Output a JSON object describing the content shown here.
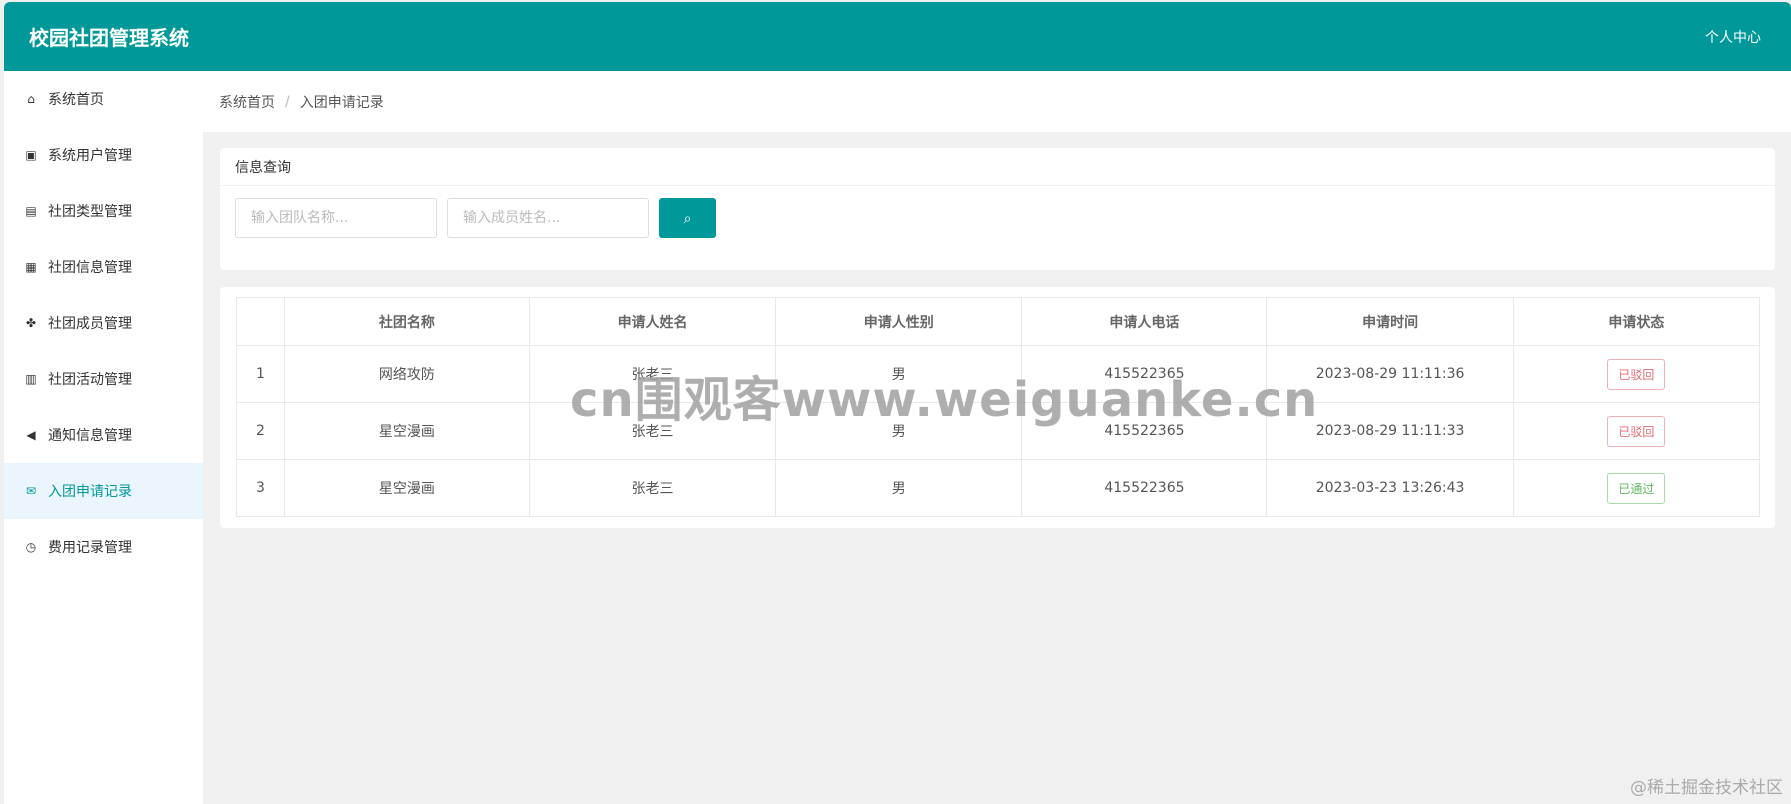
{
  "header": {
    "title": "校园社团管理系统",
    "user_center": "个人中心"
  },
  "sidebar": {
    "items": [
      {
        "label": "系统首页",
        "icon": "home-icon",
        "glyph": "⌂"
      },
      {
        "label": "系统用户管理",
        "icon": "address-book-icon",
        "glyph": "▣"
      },
      {
        "label": "社团类型管理",
        "icon": "building-icon",
        "glyph": "▤"
      },
      {
        "label": "社团信息管理",
        "icon": "train-icon",
        "glyph": "▦"
      },
      {
        "label": "社团成员管理",
        "icon": "cubes-icon",
        "glyph": "✤"
      },
      {
        "label": "社团活动管理",
        "icon": "calculator-icon",
        "glyph": "▥"
      },
      {
        "label": "通知信息管理",
        "icon": "bullhorn-icon",
        "glyph": "◀"
      },
      {
        "label": "入团申请记录",
        "icon": "envelope-open-icon",
        "glyph": "✉",
        "active": true
      },
      {
        "label": "费用记录管理",
        "icon": "clock-icon",
        "glyph": "◷"
      }
    ]
  },
  "breadcrumb": {
    "home": "系统首页",
    "sep": "/",
    "current": "入团申请记录"
  },
  "search": {
    "title": "信息查询",
    "team_placeholder": "输入团队名称...",
    "member_placeholder": "输入成员姓名...",
    "button_icon": "search-icon",
    "button_glyph": "⌕"
  },
  "table": {
    "headers": [
      "",
      "社团名称",
      "申请人姓名",
      "申请人性别",
      "申请人电话",
      "申请时间",
      "申请状态"
    ],
    "rows": [
      {
        "no": "1",
        "club": "网络攻防",
        "name": "张老三",
        "gender": "男",
        "phone": "415522365",
        "time": "2023-08-29 11:11:36",
        "status": "已驳回",
        "status_color": "#e06c75"
      },
      {
        "no": "2",
        "club": "星空漫画",
        "name": "张老三",
        "gender": "男",
        "phone": "415522365",
        "time": "2023-08-29 11:11:33",
        "status": "已驳回",
        "status_color": "#e06c75"
      },
      {
        "no": "3",
        "club": "星空漫画",
        "name": "张老三",
        "gender": "男",
        "phone": "415522365",
        "time": "2023-03-23 13:26:43",
        "status": "已通过",
        "status_color": "#5fb85f"
      }
    ]
  },
  "watermark": "cn围观客www.weiguanke.cn",
  "corner_watermark": "@稀土掘金技术社区",
  "colors": {
    "primary": "#009898",
    "rejected": "#e06c75",
    "approved": "#5fb85f"
  }
}
